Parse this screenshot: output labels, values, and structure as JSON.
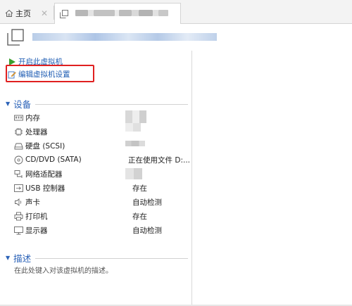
{
  "tabs": [
    {
      "label": "主页",
      "icon": "home-icon"
    },
    {
      "label": "",
      "icon": "vm-icon"
    }
  ],
  "header": {
    "vm_name": ""
  },
  "actions": {
    "power_on": "开启此虚拟机",
    "edit_settings": "编辑虚拟机设置"
  },
  "sections": {
    "devices": "设备",
    "description": "描述"
  },
  "devices": [
    {
      "icon": "memory-icon",
      "name": "内存",
      "value": ""
    },
    {
      "icon": "processor-icon",
      "name": "处理器",
      "value": ""
    },
    {
      "icon": "hard-disk-icon",
      "name": "硬盘 (SCSI)",
      "value": ""
    },
    {
      "icon": "cd-dvd-icon",
      "name": "CD/DVD (SATA)",
      "value": "正在使用文件 D:..."
    },
    {
      "icon": "network-adapter-icon",
      "name": "网络适配器",
      "value": ""
    },
    {
      "icon": "usb-icon",
      "name": "USB 控制器",
      "value": "存在"
    },
    {
      "icon": "sound-card-icon",
      "name": "声卡",
      "value": "自动检测"
    },
    {
      "icon": "printer-icon",
      "name": "打印机",
      "value": "存在"
    },
    {
      "icon": "display-icon",
      "name": "显示器",
      "value": "自动检测"
    }
  ],
  "description_placeholder": "在此处键入对该虚拟机的描述。",
  "colors": {
    "link": "#1e5cb3",
    "section": "#2c63b8",
    "highlight": "#e02020",
    "power": "#3a9e2e"
  }
}
